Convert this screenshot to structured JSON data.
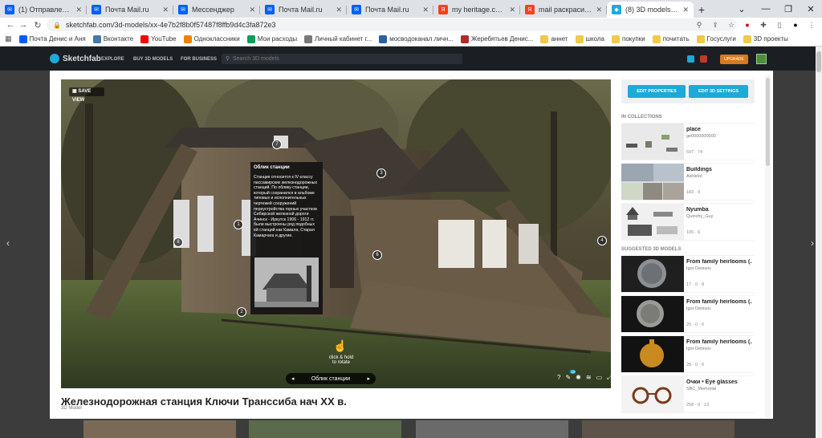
{
  "browser": {
    "tabs": [
      {
        "label": "(1) Отправленные - ",
        "icon": "mail-icon",
        "color": "#005ff9",
        "active": false
      },
      {
        "label": "Почта Mail.ru",
        "icon": "mail-icon",
        "color": "#005ff9",
        "active": false
      },
      {
        "label": "Мессенджер",
        "icon": "messenger-icon",
        "color": "#005ff9",
        "active": false
      },
      {
        "label": "Почта Mail.ru",
        "icon": "mail-icon",
        "color": "#005ff9",
        "active": false
      },
      {
        "label": "Почта Mail.ru",
        "icon": "mail-icon",
        "color": "#005ff9",
        "active": false
      },
      {
        "label": "my heritage.com — Я",
        "icon": "yandex-icon",
        "color": "#fc3f1d",
        "active": false
      },
      {
        "label": "mail раскрасить фот",
        "icon": "yandex-icon",
        "color": "#fc3f1d",
        "active": false
      },
      {
        "label": "(8) 3D models by De",
        "icon": "sketchfab-icon",
        "color": "#1caad9",
        "active": true
      }
    ],
    "new_tab": "+",
    "url": "sketchfab.com/3d-models/xx-4e7b2f8b0f57487f8ffb9d4c3fa872e3",
    "bookmarks": [
      {
        "label": "Почта Денис и Аня",
        "color": "#005ff9"
      },
      {
        "label": "Вконтакте",
        "color": "#4a76a8"
      },
      {
        "label": "YouTube",
        "color": "#ff0000"
      },
      {
        "label": "Одноклассники",
        "color": "#ee8208"
      },
      {
        "label": "Мои расходы",
        "color": "#0f9d58"
      },
      {
        "label": "Личный кабинет г...",
        "color": "#777777"
      },
      {
        "label": "мосводоканал личн...",
        "color": "#2d5fa6"
      },
      {
        "label": "Жеребятьев Денис...",
        "color": "#b02b2b"
      },
      {
        "label": "аннет",
        "color": "#f2c94c"
      },
      {
        "label": "школа",
        "color": "#f2c94c"
      },
      {
        "label": "покупки",
        "color": "#f2c94c"
      },
      {
        "label": "почитать",
        "color": "#f2c94c"
      },
      {
        "label": "Госуслуги",
        "color": "#f2c94c"
      },
      {
        "label": "3D проекты",
        "color": "#f2c94c"
      }
    ]
  },
  "site": {
    "logo": "Sketchfab",
    "nav": [
      "EXPLORE",
      "BUY 3D MODELS",
      "FOR BUSINESS"
    ],
    "search_placeholder": "Search 3D models",
    "upgrade": "UPGRADE"
  },
  "viewer": {
    "save_view": "SAVE VIEW",
    "annotation_title": "Облик станции",
    "annotation_text": "Станция относится к IV классу пассажирских железнодорожных станций. По облику станции, который сохранился в альбоме типовых и исполнительных чертежей сооружений переустройства горных участков Сибирской железной дороги Ачинск - Иркутск 1906 - 1912 гг. были выстроены ряд подобных ей станций как Камала, Старая Камарчага и другие.",
    "hotspots": [
      "1",
      "2",
      "3",
      "4",
      "6",
      "7",
      "8"
    ],
    "hint_line1": "click & hold",
    "hint_line2": "to rotate",
    "annotation_nav_label": "Облик станции",
    "annotation_count": "10"
  },
  "model": {
    "title": "Железнодорожная станция Ключи Транссиба нач XX в.",
    "type": "3D Model"
  },
  "panel": {
    "edit_properties": "EDIT PROPERTIES",
    "edit_3d_settings": "EDIT 3D SETTINGS",
    "collections_label": "IN COLLECTIONS",
    "collections": [
      {
        "title": "place",
        "author": "ge0000000000",
        "stats": "597  ·  74"
      },
      {
        "title": "Buildings",
        "author": "Ashleloi",
        "stats": "183  ·  9"
      },
      {
        "title": "Nyumba",
        "author": "Quinchy_Guy",
        "stats": "105  ·  6"
      }
    ],
    "suggested_label": "SUGGESTED 3D MODELS",
    "suggested": [
      {
        "title": "From family heirlooms (...",
        "author": "Igor Denisov",
        "stats": "17  ·  0  ·  8"
      },
      {
        "title": "From family heirlooms (...",
        "author": "Igor Denisov",
        "stats": "20  ·  0  ·  6"
      },
      {
        "title": "From family heirlooms (...",
        "author": "Igor Denisov",
        "stats": "28  ·  0  ·  6"
      },
      {
        "title": "Очки • Eye glasses",
        "author": "SBC_Memorial",
        "stats": "258  ·  0  ·  13"
      }
    ]
  }
}
